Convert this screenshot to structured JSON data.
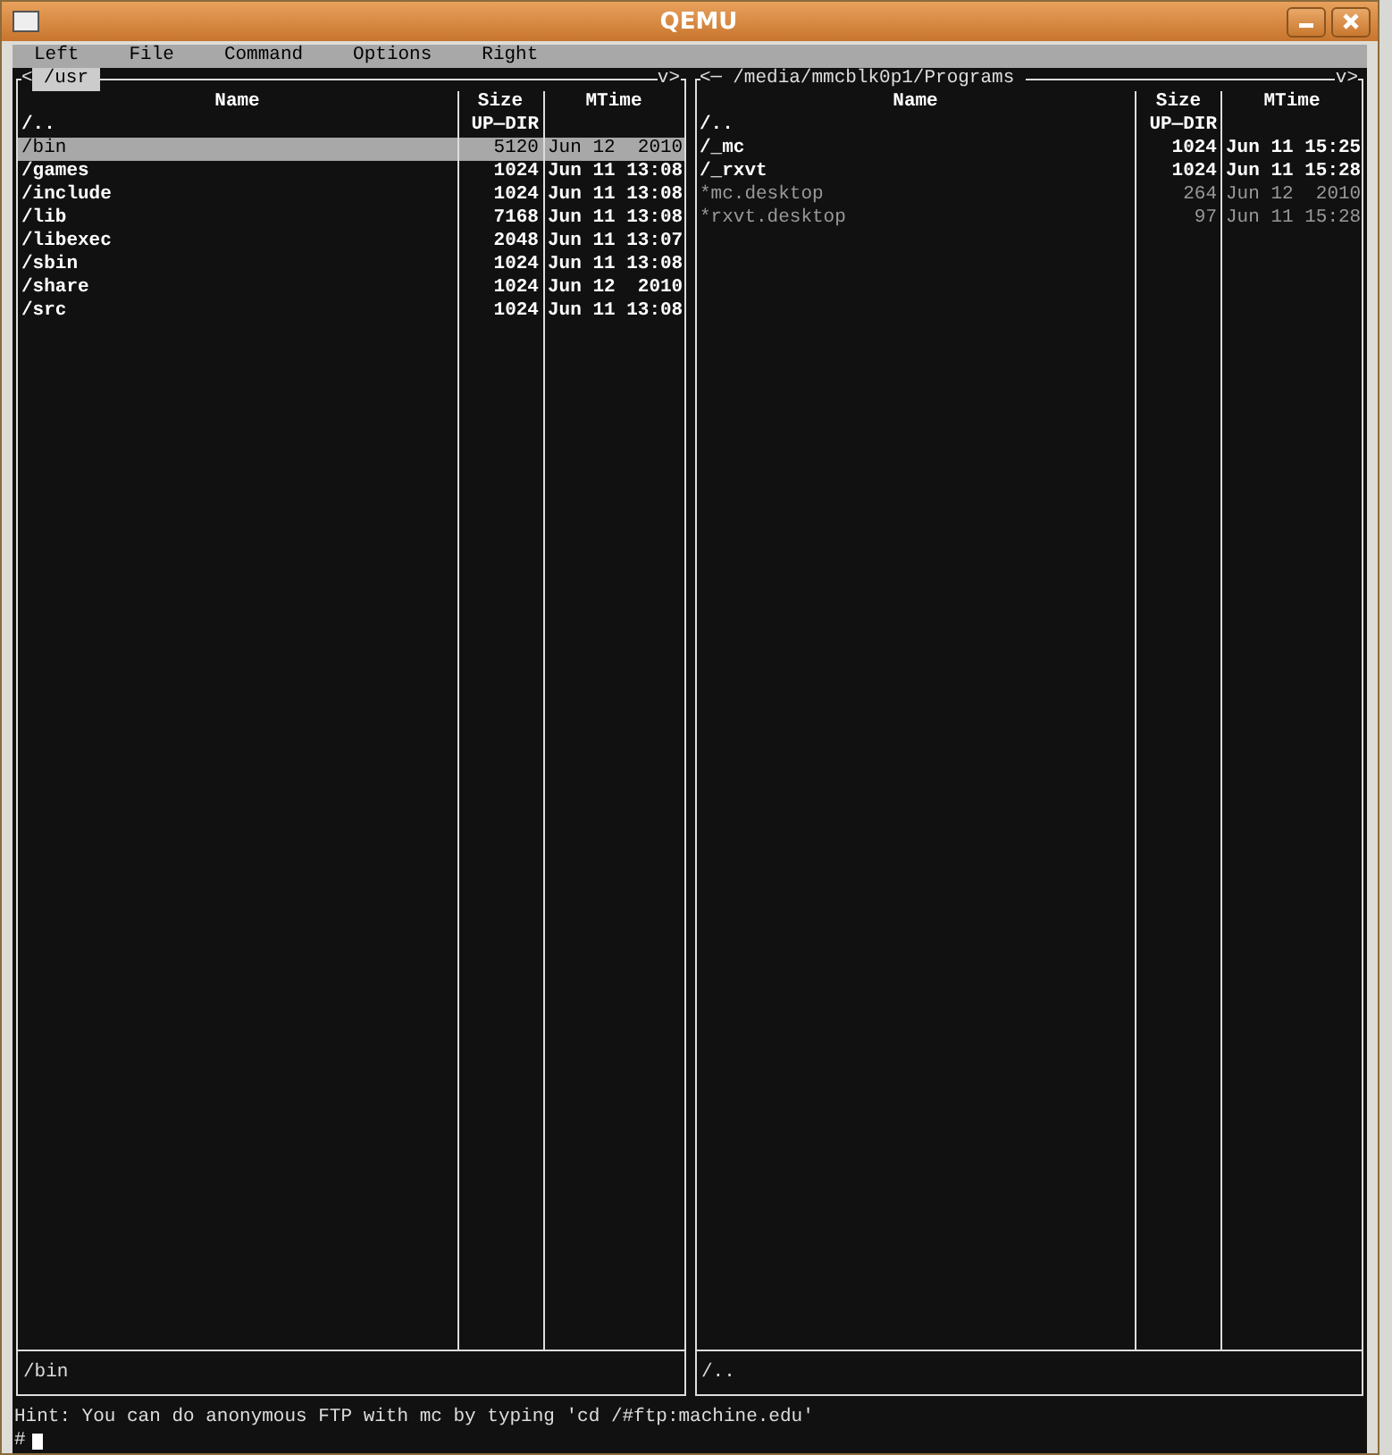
{
  "window": {
    "title": "QEMU"
  },
  "menu": [
    {
      "label": "Left"
    },
    {
      "label": "File"
    },
    {
      "label": "Command"
    },
    {
      "label": "Options"
    },
    {
      "label": "Right"
    }
  ],
  "panels": [
    {
      "path": "/usr",
      "active": true,
      "corner_left": "<",
      "corner_right": "v>",
      "columns": [
        "Name",
        "Size",
        "MTime"
      ],
      "rows": [
        {
          "kind": "updir",
          "name": "/..",
          "size": "UP—DIR",
          "mtime": "",
          "selected": false
        },
        {
          "kind": "dir",
          "name": "/bin",
          "size": "5120",
          "mtime": "Jun 12  2010",
          "selected": true
        },
        {
          "kind": "dir",
          "name": "/games",
          "size": "1024",
          "mtime": "Jun 11 13:08",
          "selected": false
        },
        {
          "kind": "dir",
          "name": "/include",
          "size": "1024",
          "mtime": "Jun 11 13:08",
          "selected": false
        },
        {
          "kind": "dir",
          "name": "/lib",
          "size": "7168",
          "mtime": "Jun 11 13:08",
          "selected": false
        },
        {
          "kind": "dir",
          "name": "/libexec",
          "size": "2048",
          "mtime": "Jun 11 13:07",
          "selected": false
        },
        {
          "kind": "dir",
          "name": "/sbin",
          "size": "1024",
          "mtime": "Jun 11 13:08",
          "selected": false
        },
        {
          "kind": "dir",
          "name": "/share",
          "size": "1024",
          "mtime": "Jun 12  2010",
          "selected": false
        },
        {
          "kind": "dir",
          "name": "/src",
          "size": "1024",
          "mtime": "Jun 11 13:08",
          "selected": false
        }
      ],
      "mini_status": "/bin"
    },
    {
      "path": "/media/mmcblk0p1/Programs",
      "active": false,
      "corner_left": "<─",
      "corner_right": "v>",
      "columns": [
        "Name",
        "Size",
        "MTime"
      ],
      "rows": [
        {
          "kind": "updir",
          "name": "/..",
          "size": "UP—DIR",
          "mtime": "",
          "selected": false
        },
        {
          "kind": "dir",
          "name": "/_mc",
          "size": "1024",
          "mtime": "Jun 11 15:25",
          "selected": false
        },
        {
          "kind": "dir",
          "name": "/_rxvt",
          "size": "1024",
          "mtime": "Jun 11 15:28",
          "selected": false
        },
        {
          "kind": "file",
          "name": "*mc.desktop",
          "size": "264",
          "mtime": "Jun 12  2010",
          "selected": false
        },
        {
          "kind": "file",
          "name": "*rxvt.desktop",
          "size": "97",
          "mtime": "Jun 11 15:28",
          "selected": false
        }
      ],
      "mini_status": "/.."
    }
  ],
  "hint": "Hint: You can do anonymous FTP with mc by typing 'cd /#ftp:machine.edu'",
  "prompt": "#"
}
